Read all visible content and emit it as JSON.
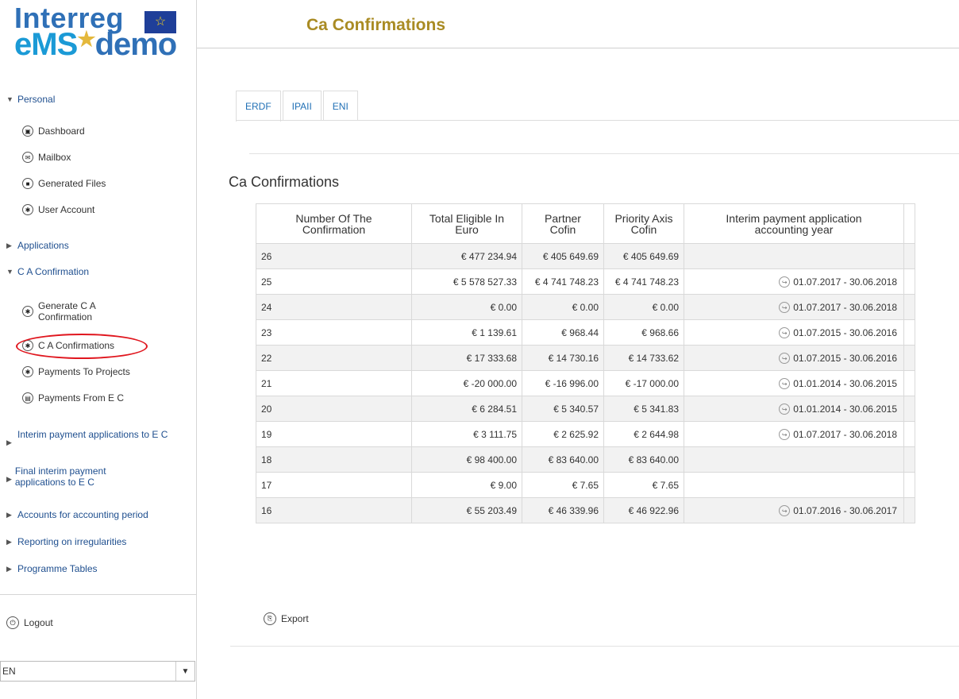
{
  "app": {
    "logo_line1": "Interreg",
    "logo_line2_a": "eMS",
    "logo_line2_b": "demo",
    "logo_flag_text": "EUROPEAN UNION"
  },
  "header": {
    "title": "Ca Confirmations"
  },
  "sidebar": {
    "personal": {
      "label": "Personal",
      "items": [
        {
          "label": "Dashboard",
          "icon": "dashboard-icon"
        },
        {
          "label": "Mailbox",
          "icon": "mail-icon"
        },
        {
          "label": "Generated Files",
          "icon": "file-icon"
        },
        {
          "label": "User Account",
          "icon": "gear-icon"
        }
      ]
    },
    "applications": "Applications",
    "ca_confirmation": {
      "label": "C A Confirmation",
      "items": [
        {
          "label": "Generate C A Confirmation",
          "icon": "gear-icon"
        },
        {
          "label": "C A Confirmations",
          "icon": "gear-icon"
        },
        {
          "label": "Payments To Projects",
          "icon": "gear-icon"
        },
        {
          "label": "Payments From E C",
          "icon": "list-icon"
        }
      ]
    },
    "interim": "Interim payment applications to E C",
    "final_interim": "Final interim payment applications to E C",
    "accounts": "Accounts for accounting period",
    "reporting": "Reporting on irregularities",
    "programme_tables": "Programme Tables",
    "logout": "Logout",
    "language": "EN"
  },
  "tabs": [
    "ERDF",
    "IPAII",
    "ENI"
  ],
  "section_title": "Ca Confirmations",
  "table": {
    "headers": [
      "Number Of The Confirmation",
      "Total Eligible In Euro",
      "Partner Cofin",
      "Priority Axis Cofin",
      "Interim payment application accounting year"
    ],
    "rows": [
      [
        "26",
        "€ 477 234.94",
        "€ 405 649.69",
        "€ 405 649.69",
        ""
      ],
      [
        "25",
        "€ 5 578 527.33",
        "€ 4 741 748.23",
        "€ 4 741 748.23",
        "01.07.2017 - 30.06.2018"
      ],
      [
        "24",
        "€ 0.00",
        "€ 0.00",
        "€ 0.00",
        "01.07.2017 - 30.06.2018"
      ],
      [
        "23",
        "€ 1 139.61",
        "€ 968.44",
        "€ 968.66",
        "01.07.2015 - 30.06.2016"
      ],
      [
        "22",
        "€ 17 333.68",
        "€ 14 730.16",
        "€ 14 733.62",
        "01.07.2015 - 30.06.2016"
      ],
      [
        "21",
        "€ -20 000.00",
        "€ -16 996.00",
        "€ -17 000.00",
        "01.01.2014 - 30.06.2015"
      ],
      [
        "20",
        "€ 6 284.51",
        "€ 5 340.57",
        "€ 5 341.83",
        "01.01.2014 - 30.06.2015"
      ],
      [
        "19",
        "€ 3 111.75",
        "€ 2 625.92",
        "€ 2 644.98",
        "01.07.2017 - 30.06.2018"
      ],
      [
        "18",
        "€ 98 400.00",
        "€ 83 640.00",
        "€ 83 640.00",
        ""
      ],
      [
        "17",
        "€ 9.00",
        "€ 7.65",
        "€ 7.65",
        ""
      ],
      [
        "16",
        "€ 55 203.49",
        "€ 46 339.96",
        "€ 46 922.96",
        "01.07.2016 - 30.06.2017"
      ]
    ]
  },
  "export_label": "Export",
  "colors": {
    "title": "#a98b23",
    "link": "#1f6fb5",
    "annotation": "#e0161e"
  }
}
